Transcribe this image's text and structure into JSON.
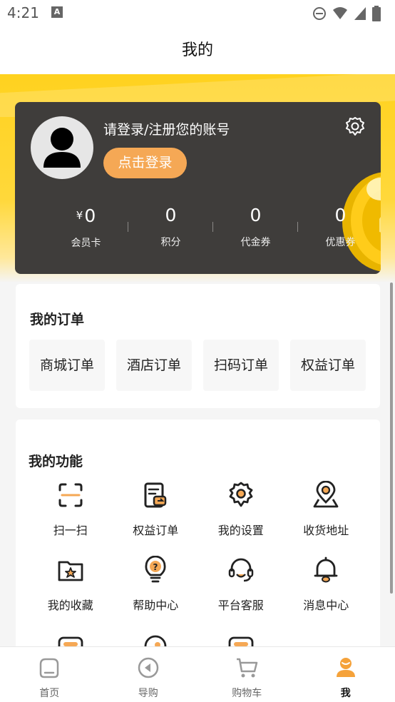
{
  "status_bar": {
    "time": "4:21",
    "notif_glyph": "A"
  },
  "header": {
    "title": "我的"
  },
  "member_card": {
    "login_hint": "请登录/注册您的账号",
    "login_button": "点击登录",
    "stats": [
      {
        "currency": "¥",
        "value": "0",
        "label": "会员卡"
      },
      {
        "value": "0",
        "label": "积分"
      },
      {
        "value": "0",
        "label": "代金券"
      },
      {
        "value": "0",
        "label": "优惠券"
      }
    ]
  },
  "orders": {
    "title": "我的订单",
    "items": [
      {
        "label": "商城订单"
      },
      {
        "label": "酒店订单"
      },
      {
        "label": "扫码订单"
      },
      {
        "label": "权益订单"
      }
    ]
  },
  "functions": {
    "title": "我的功能",
    "items": [
      {
        "label": "扫一扫",
        "icon": "scan-icon"
      },
      {
        "label": "权益订单",
        "icon": "benefit-order-icon"
      },
      {
        "label": "我的设置",
        "icon": "settings-icon"
      },
      {
        "label": "收货地址",
        "icon": "location-icon"
      },
      {
        "label": "我的收藏",
        "icon": "favorites-folder-icon"
      },
      {
        "label": "帮助中心",
        "icon": "help-bulb-icon"
      },
      {
        "label": "平台客服",
        "icon": "customer-service-icon"
      },
      {
        "label": "消息中心",
        "icon": "bell-icon"
      }
    ]
  },
  "tab_bar": {
    "tabs": [
      {
        "label": "首页",
        "icon": "home-icon",
        "active": false
      },
      {
        "label": "导购",
        "icon": "guide-icon",
        "active": false
      },
      {
        "label": "购物车",
        "icon": "cart-icon",
        "active": false
      },
      {
        "label": "我",
        "icon": "profile-icon",
        "active": true
      }
    ]
  },
  "colors": {
    "accent_yellow": "#ffd21f",
    "accent_orange": "#f5a855",
    "card_dark": "#3f3d3b",
    "icon_dark": "#222222"
  }
}
